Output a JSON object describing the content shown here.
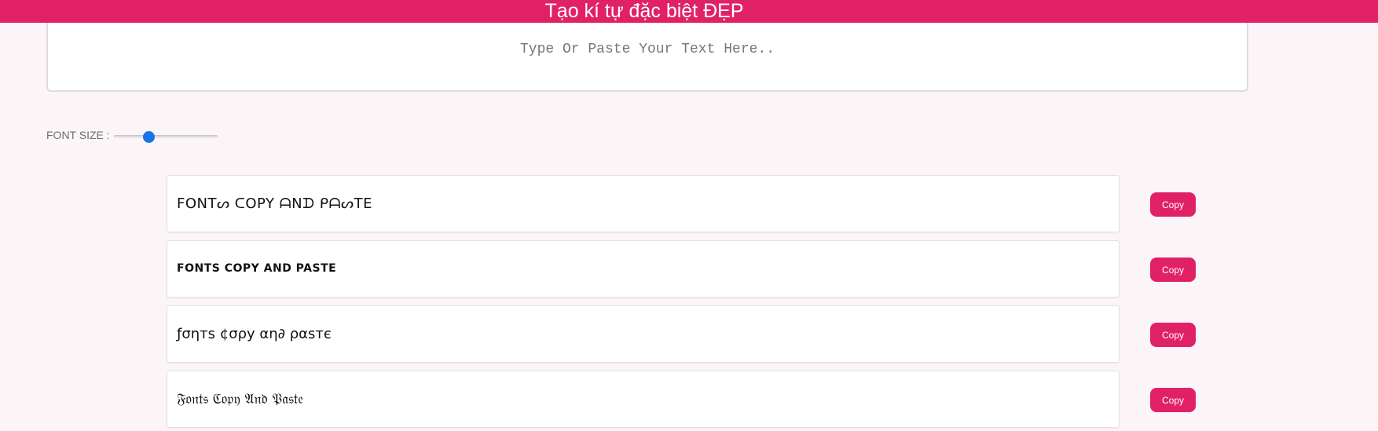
{
  "header": {
    "title": "Tạo kí tự đặc biệt ĐẸP",
    "background_color": "#e12166"
  },
  "input": {
    "placeholder": "Type Or Paste Your Text Here..",
    "value": ""
  },
  "font_size": {
    "label": "FONT SIZE :",
    "slider_fraction": 0.33
  },
  "results": [
    {
      "text": "FONTᔕ ᑕOPY ᗩNᗪ ᑭᗩᔕTE",
      "button_label": "Copy"
    },
    {
      "text": "FONTS COPY AND PASTE",
      "button_label": "Copy"
    },
    {
      "text": "ƒσηтѕ ¢σρу αη∂ ραѕтє",
      "button_label": "Copy"
    },
    {
      "text": "𝔉𝔬𝔫𝔱𝔰 ℭ𝔬𝔭𝔶 𝔄𝔫𝔡 𝔓𝔞𝔰𝔱𝔢",
      "button_label": "Copy"
    }
  ],
  "colors": {
    "accent": "#e12166",
    "page_background": "#fcf5f7",
    "slider_thumb": "#1a73e8"
  }
}
